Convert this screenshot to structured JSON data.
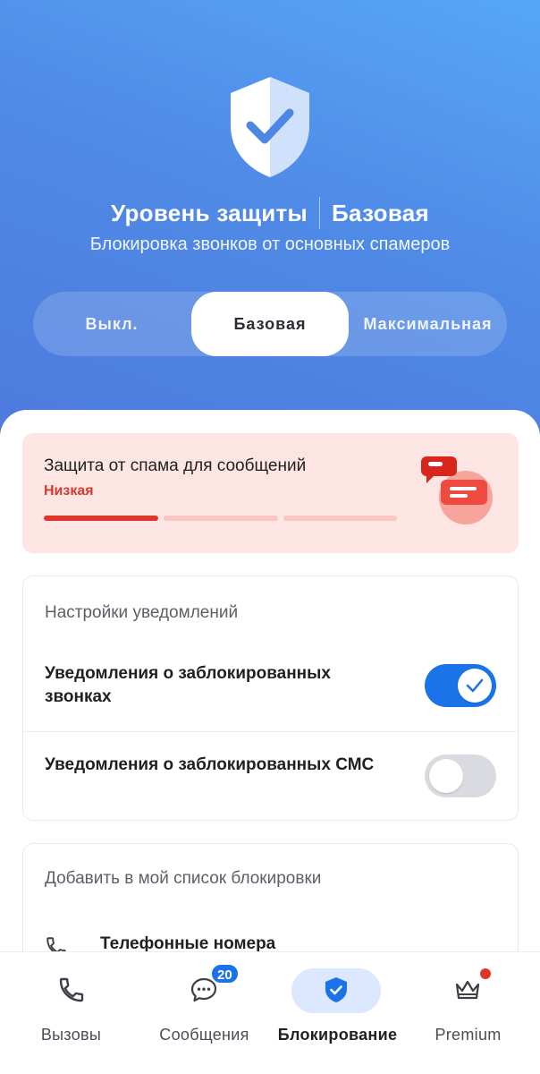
{
  "header": {
    "title": "Уровень защиты",
    "level": "Базовая",
    "subtitle": "Блокировка звонков от основных спамеров",
    "accent_color": "#4f8ae6",
    "shield_icon": "shield-check-icon"
  },
  "protection_modes": {
    "options": [
      "Выкл.",
      "Базовая",
      "Максимальная"
    ],
    "selected": "Базовая"
  },
  "spam_card": {
    "title": "Защита от спама для сообщений",
    "level_label": "Низкая",
    "level_fraction": 0.333,
    "color": "#e0352b",
    "illustration": "message-chat-illustration"
  },
  "notifications": {
    "title": "Настройки уведомлений",
    "rows": [
      {
        "label": "Уведомления о заблокированных звонках",
        "enabled": true
      },
      {
        "label": "Уведомления о заблокированных СМС",
        "enabled": false
      }
    ]
  },
  "block_list": {
    "title": "Добавить в мой список блокировки",
    "items": [
      {
        "label": "Телефонные номера",
        "icon": "phone-icon"
      }
    ]
  },
  "bottom_nav": {
    "items": [
      {
        "label": "Вызовы",
        "icon": "phone-icon",
        "active": false
      },
      {
        "label": "Сообщения",
        "icon": "chat-bubble-icon",
        "active": false,
        "badge": "20"
      },
      {
        "label": "Блокирование",
        "icon": "shield-check-icon",
        "active": true
      },
      {
        "label": "Premium",
        "icon": "crown-icon",
        "active": false,
        "dot": true
      }
    ]
  }
}
